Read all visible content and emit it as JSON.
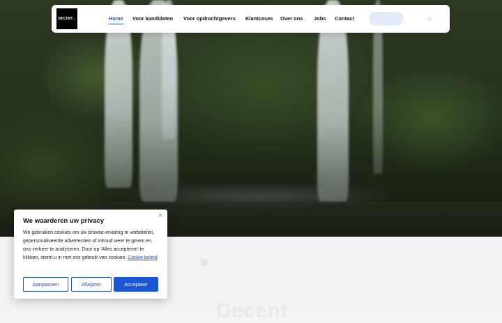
{
  "header": {
    "logo_text": "DECENT.",
    "nav": [
      {
        "label": "Home",
        "active": true
      },
      {
        "label": "Voor kandidaten",
        "active": false
      },
      {
        "label": "Voor opdrachtgevers",
        "active": false
      },
      {
        "label": "Klantcases",
        "active": false
      },
      {
        "label": "Over ons",
        "active": false
      },
      {
        "label": "Jobs",
        "active": false
      },
      {
        "label": "Contact",
        "active": false
      }
    ]
  },
  "content": {
    "faded_heading": "Decent"
  },
  "cookie": {
    "title": "We waarderen uw privacy",
    "text": "We gebruiken cookies om uw browse-ervaring te verbeteren, gepersonaliseerde advertenties of inhoud weer te geven en ons verkeer te analyseren. Door op 'Alles accepteren' te klikken, stemt u in met ons gebruik van cookies.",
    "link": "Cookie beleid",
    "close": "×",
    "buttons": {
      "customize": "Aanpassen",
      "reject": "Afwijzen",
      "accept": "Accepteer"
    }
  },
  "colors": {
    "accent": "#1f4fb8",
    "primary_button": "#1a56d6"
  }
}
